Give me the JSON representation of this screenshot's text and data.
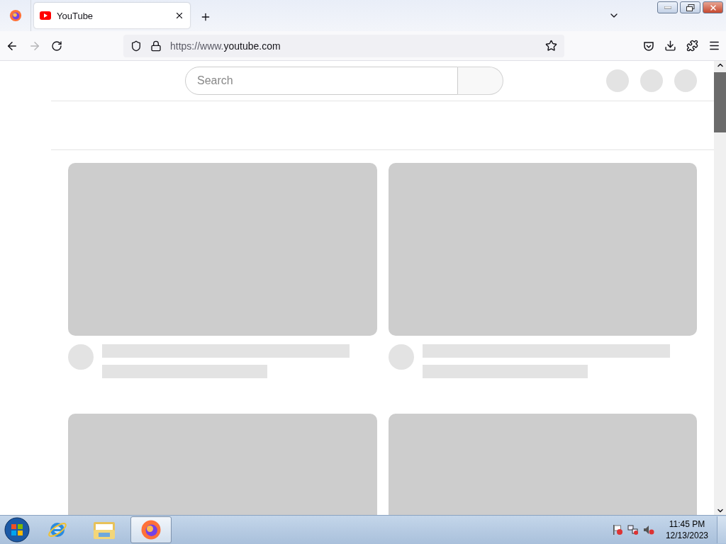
{
  "browser": {
    "tabs": [
      {
        "title": "YouTube",
        "selected": true
      }
    ],
    "url": "https://www.**youtube.com**"
  },
  "page": {
    "search": {
      "placeholder": "Search"
    },
    "header_buttons": [
      {
        "kind": "skeleton"
      },
      {
        "kind": "skeleton"
      },
      {
        "kind": "skeleton"
      }
    ],
    "video_cards": [
      {
        "kind": "skeleton"
      },
      {
        "kind": "skeleton"
      },
      {
        "kind": "skeleton"
      },
      {
        "kind": "skeleton"
      }
    ]
  },
  "taskbar": {
    "apps": [
      {
        "kind": "ie",
        "selected": false
      },
      {
        "kind": "explorer",
        "selected": false
      },
      {
        "kind": "firefox",
        "selected": true
      }
    ],
    "time": "11:45 PM",
    "date": "12/13/2023"
  }
}
